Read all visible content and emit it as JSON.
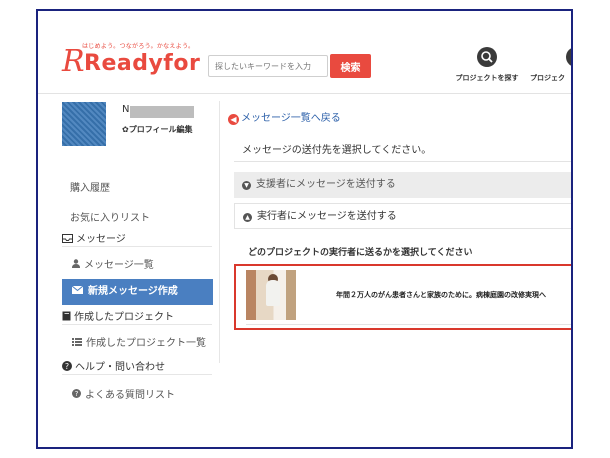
{
  "header": {
    "logo_tagline": "はじめよう。つながろう。かなえよう。",
    "logo_mark": "R",
    "logo_text": "Readyfor",
    "search_placeholder": "探したいキーワードを入力",
    "search_button": "検索",
    "nav": [
      {
        "label": "プロジェクトを探す",
        "icon": "search-icon"
      },
      {
        "label": "プロジェク"
      }
    ]
  },
  "sidebar": {
    "user_initial": "N",
    "profile_edit": "✿プロフィール編集",
    "links": [
      "購入履歴",
      "お気に入りリスト"
    ],
    "message_section": "メッセージ",
    "message_list": "メッセージ一覧",
    "new_message": "新規メッセージ作成",
    "project_section": "作成したプロジェクト",
    "project_list": "作成したプロジェクト一覧",
    "help_section": "ヘルプ・問い合わせ",
    "faq": "よくある質問リスト"
  },
  "main": {
    "back_link": "メッセージ一覧へ戻る",
    "select_recipient": "メッセージの送付先を選択してください。",
    "option_supporter": "支援者にメッセージを送付する",
    "option_executor": "実行者にメッセージを送付する",
    "choose_project": "どのプロジェクトの実行者に送るかを選択してください",
    "project_title": "年間２万人のがん患者さんと家族のために。病棟庭園の改修実現へ"
  },
  "colors": {
    "brand": "#e94a3f",
    "active": "#4a7fc1",
    "link": "#2a5ea8",
    "frame": "#1a237e"
  }
}
